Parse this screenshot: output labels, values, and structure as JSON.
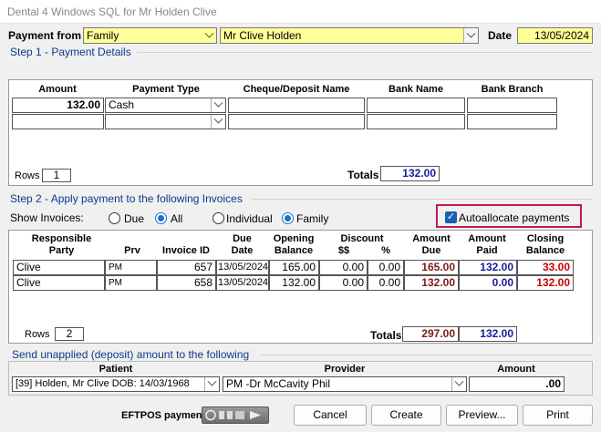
{
  "window": {
    "title": "Dental 4 Windows SQL for Mr  Holden  Clive"
  },
  "header": {
    "payment_from_label": "Payment from",
    "payment_from_value": "Family",
    "patient_value": "Mr Clive  Holden",
    "date_label": "Date",
    "date_value": "13/05/2024"
  },
  "step1": {
    "title": "Step 1 - Payment Details",
    "columns": [
      "Amount",
      "Payment Type",
      "Cheque/Deposit Name",
      "Bank Name",
      "Bank Branch"
    ],
    "rows": [
      {
        "amount": "132.00",
        "payment_type": "Cash",
        "cheque_name": "",
        "bank_name": "",
        "bank_branch": ""
      },
      {
        "amount": "",
        "payment_type": "",
        "cheque_name": "",
        "bank_name": "",
        "bank_branch": ""
      }
    ],
    "rows_label": "Rows",
    "rows_count": "1",
    "totals_label": "Totals",
    "totals_value": "132.00"
  },
  "step2": {
    "title": "Step 2 - Apply payment to the following Invoices",
    "show_invoices_label": "Show Invoices:",
    "radios": {
      "due": "Due",
      "all": "All",
      "individual": "Individual",
      "family": "Family"
    },
    "autoallocate_label": "Autoallocate payments",
    "columns": {
      "responsible_party": "Responsible\nParty",
      "prv": "Prv",
      "invoice_id": "Invoice ID",
      "due_date": "Due\nDate",
      "opening_balance": "Opening\nBalance",
      "discount": "Discount",
      "discount_dollars": "$$",
      "discount_pct": "%",
      "amount_due": "Amount\nDue",
      "amount_paid": "Amount\nPaid",
      "closing_balance": "Closing\nBalance"
    },
    "invoices": [
      {
        "party": "Clive",
        "prv": "PM",
        "invoice_id": "657",
        "due_date": "13/05/2024",
        "opening": "165.00",
        "disc_dollars": "0.00",
        "disc_pct": "0.00",
        "amount_due": "165.00",
        "amount_paid": "132.00",
        "closing": "33.00"
      },
      {
        "party": "Clive",
        "prv": "PM",
        "invoice_id": "658",
        "due_date": "13/05/2024",
        "opening": "132.00",
        "disc_dollars": "0.00",
        "disc_pct": "0.00",
        "amount_due": "132.00",
        "amount_paid": "0.00",
        "closing": "132.00"
      }
    ],
    "rows_label": "Rows",
    "rows_count": "2",
    "totals_label": "Totals",
    "total_due": "297.00",
    "total_paid": "132.00"
  },
  "unapplied": {
    "title": "Send unapplied (deposit) amount to the following",
    "patient_label": "Patient",
    "provider_label": "Provider",
    "amount_label": "Amount",
    "patient_value": "[39] Holden, Mr Clive DOB: 14/03/1968",
    "provider_value": "PM -Dr McCavity Phil",
    "amount_value": ".00"
  },
  "footer": {
    "eftpos_label": "EFTPOS payment",
    "cancel_label": "Cancel",
    "create_label": "Create",
    "preview_label": "Preview...",
    "print_label": "Print"
  },
  "colors": {
    "field_yellow": "#ffff99",
    "group_title_blue": "#0b3a8a",
    "highlight_border": "#c2185b",
    "radio_accent": "#1a73c9"
  }
}
